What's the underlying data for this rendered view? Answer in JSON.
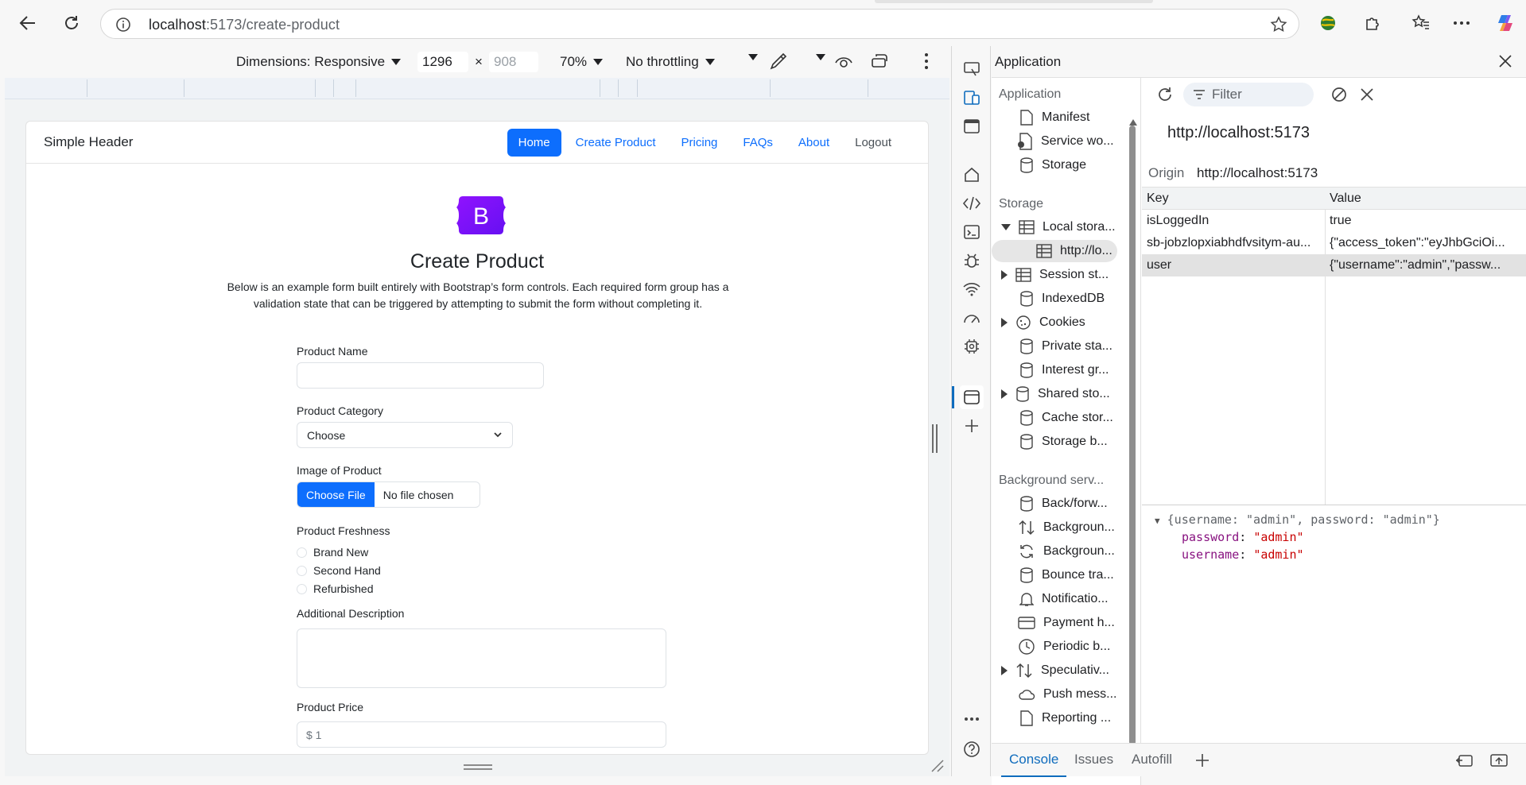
{
  "browser": {
    "url_host": "localhost",
    "url_path": ":5173/create-product"
  },
  "device_toolbar": {
    "dimensions_label": "Dimensions: Responsive",
    "width": "1296",
    "height": "908",
    "times": "×",
    "zoom": "70%",
    "throttling": "No throttling"
  },
  "site": {
    "brand": "Simple Header",
    "nav": [
      "Home",
      "Create Product",
      "Pricing",
      "FAQs",
      "About",
      "Logout"
    ],
    "logo_letter": "B",
    "title": "Create Product",
    "description": "Below is an example form built entirely with Bootstrap’s form controls. Each required form group has a validation state that can be triggered by attempting to submit the form without completing it.",
    "labels": {
      "name": "Product Name",
      "category": "Product Category",
      "image": "Image of Product",
      "freshness": "Product Freshness",
      "description": "Additional Description",
      "price": "Product Price"
    },
    "category_selected": "Choose",
    "file_button": "Choose File",
    "file_status": "No file chosen",
    "freshness_options": [
      "Brand New",
      "Second Hand",
      "Refurbished"
    ],
    "price_placeholder": "$ 1"
  },
  "devtools": {
    "title": "Application",
    "sections": {
      "application": "Application",
      "storage": "Storage",
      "background": "Background serv..."
    },
    "app_items": [
      "Manifest",
      "Service wo...",
      "Storage"
    ],
    "storage_items": {
      "local": "Local stora...",
      "local_child": "http://lo...",
      "session": "Session st...",
      "indexeddb": "IndexedDB",
      "cookies": "Cookies",
      "private": "Private sta...",
      "interest": "Interest gr...",
      "shared": "Shared sto...",
      "cache": "Cache stor...",
      "bucket": "Storage b..."
    },
    "bg_items": [
      "Back/forw...",
      "Backgroun...",
      "Backgroun...",
      "Bounce tra...",
      "Notificatio...",
      "Payment h...",
      "Periodic b...",
      "Speculativ...",
      "Push mess...",
      "Reporting ..."
    ],
    "filter_placeholder": "Filter",
    "origin_title": "http://localhost:5173",
    "origin_label": "Origin",
    "origin_value": "http://localhost:5173",
    "table_headers": [
      "Key",
      "Value"
    ],
    "rows": [
      {
        "key": "isLoggedIn",
        "value": "true"
      },
      {
        "key": "sb-jobzlopxiabhdfvsitym-au...",
        "value": "{\"access_token\":\"eyJhbGciOi..."
      },
      {
        "key": "user",
        "value": "{\"username\":\"admin\",\"passw..."
      }
    ],
    "preview": {
      "summary": "{username: \"admin\", password: \"admin\"}",
      "k1": "password",
      "v1": "\"admin\"",
      "k2": "username",
      "v2": "\"admin\"",
      "sep": ": "
    },
    "drawer_tabs": [
      "Console",
      "Issues",
      "Autofill"
    ]
  },
  "colors": {
    "bootstrap_primary": "#0d6efd",
    "bootstrap_purple": "#7a11f0",
    "devtools_accent": "#0f6cbd"
  }
}
